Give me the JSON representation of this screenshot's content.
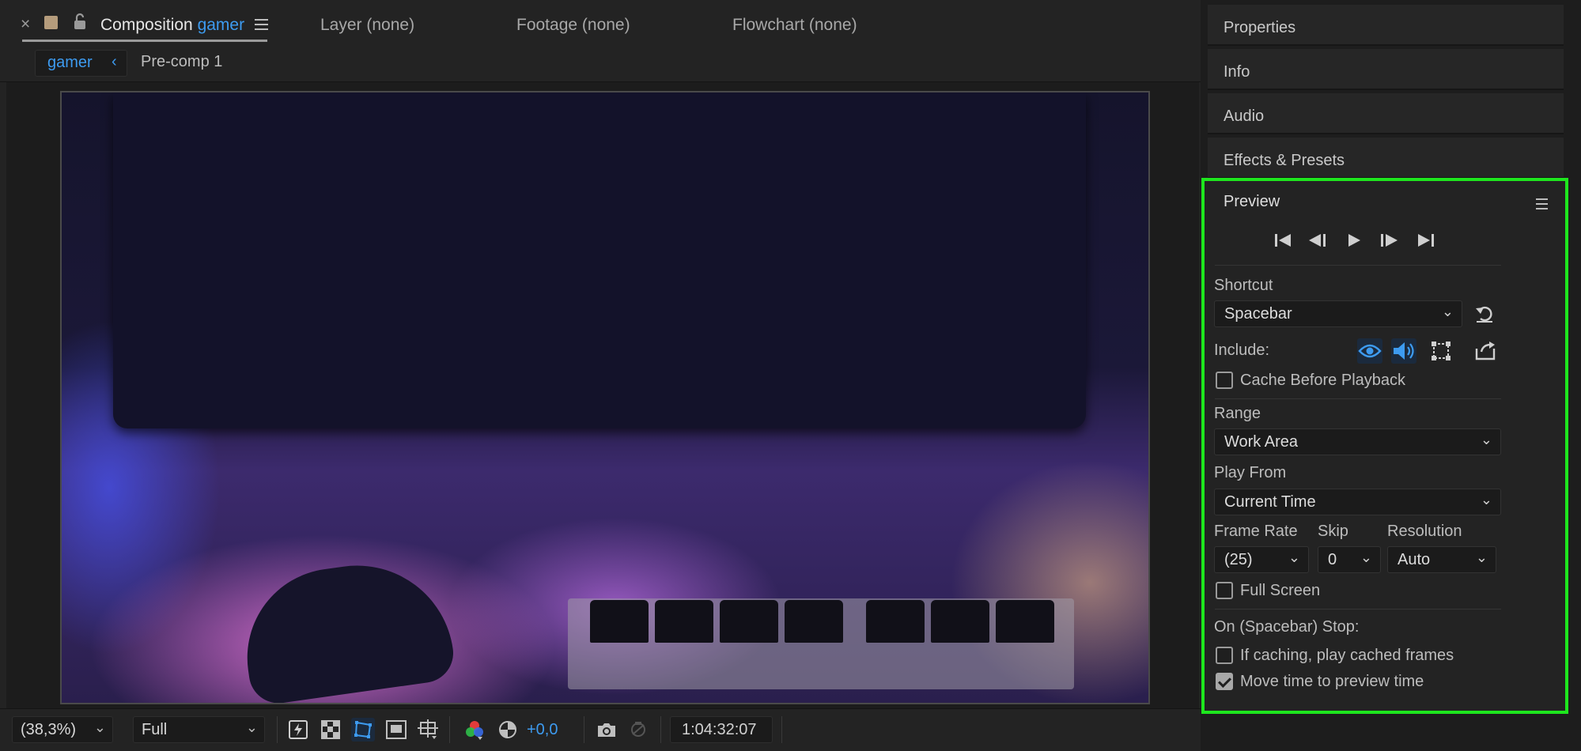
{
  "tabs": {
    "close_symbol": "×",
    "composition_label": "Composition",
    "composition_name": "gamer",
    "layer": "Layer (none)",
    "footage": "Footage (none)",
    "flowchart": "Flowchart (none)"
  },
  "breadcrumb": {
    "current": "gamer",
    "chevron": "‹",
    "next": "Pre-comp 1"
  },
  "toolbar": {
    "zoom": "(38,3%)",
    "resolution": "Full",
    "exposure": "+0,0",
    "timecode": "1:04:32:07"
  },
  "right_panels": {
    "properties": "Properties",
    "info": "Info",
    "audio": "Audio",
    "effects": "Effects & Presets"
  },
  "preview": {
    "title": "Preview",
    "shortcut_label": "Shortcut",
    "shortcut_value": "Spacebar",
    "include_label": "Include:",
    "cache_before_playback": "Cache Before Playback",
    "cache_checked": false,
    "range_label": "Range",
    "range_value": "Work Area",
    "play_from_label": "Play From",
    "play_from_value": "Current Time",
    "frame_rate_label": "Frame Rate",
    "frame_rate_value": "(25)",
    "skip_label": "Skip",
    "skip_value": "0",
    "resolution_label": "Resolution",
    "resolution_value": "Auto",
    "full_screen": "Full Screen",
    "full_screen_checked": false,
    "stop_label": "On (Spacebar) Stop:",
    "if_caching": "If caching, play cached frames",
    "if_caching_checked": false,
    "move_time": "Move time to preview time",
    "move_time_checked": true
  },
  "colors": {
    "accent_blue": "#3d9bf0",
    "highlight_green": "#1ee61e"
  }
}
